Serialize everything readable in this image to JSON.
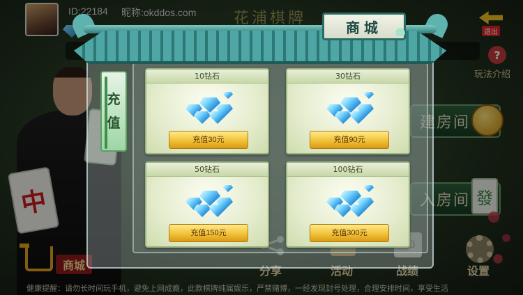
{
  "header": {
    "user_id": "ID:22184",
    "nickname": "昵称:okddos.com",
    "game_title": "花浦棋牌",
    "exit_label": "退出",
    "help_label": "玩法介绍"
  },
  "background_buttons": {
    "create_room": "建房间",
    "join_room": "入房间"
  },
  "bottom_nav": {
    "shop": "商城",
    "share": "分享",
    "activity": "活动",
    "record": "战绩",
    "record_icon_text": "2 3",
    "settings": "设置"
  },
  "health_tip": "健康提醒：请勿长时间玩手机，避免上网成瘾，此款棋牌纯属娱乐，严禁赌博，一经发现封号处理，合理安排时间，享受生活",
  "store": {
    "title": "商城",
    "tab_label": "充值",
    "items": [
      {
        "name": "10钻石",
        "button": "充值30元"
      },
      {
        "name": "30钻石",
        "button": "充值90元"
      },
      {
        "name": "50钻石",
        "button": "充值150元"
      },
      {
        "name": "100钻石",
        "button": "充值300元"
      }
    ]
  },
  "tiles": {
    "zhong": "中",
    "fa": "發"
  },
  "colors": {
    "roof_teal": "#3f8f8b",
    "gold_button": "#f1c238",
    "diamond_blue": "#1f86d6"
  }
}
